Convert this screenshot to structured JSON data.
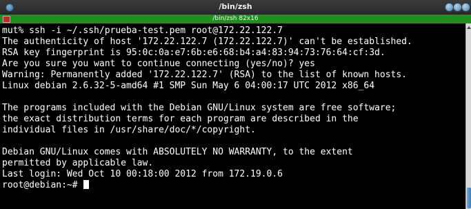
{
  "window": {
    "title": "/bin/zsh"
  },
  "tab": {
    "label": "/bin/zsh 82x16"
  },
  "terminal": {
    "lines": [
      "mut% ssh -i ~/.ssh/prueba-test.pem root@172.22.122.7",
      "The authenticity of host '172.22.122.7 (172.22.122.7)' can't be established.",
      "RSA key fingerprint is 95:0c:0a:e7:6b:e6:68:b4:a4:83:94:73:76:64:cf:3d.",
      "Are you sure you want to continue connecting (yes/no)? yes",
      "Warning: Permanently added '172.22.122.7' (RSA) to the list of known hosts.",
      "Linux debian 2.6.32-5-amd64 #1 SMP Sun May 6 04:00:17 UTC 2012 x86_64",
      "",
      "The programs included with the Debian GNU/Linux system are free software;",
      "the exact distribution terms for each program are described in the",
      "individual files in /usr/share/doc/*/copyright.",
      "",
      "Debian GNU/Linux comes with ABSOLUTELY NO WARRANTY, to the extent",
      "permitted by applicable law.",
      "Last login: Wed Oct 10 00:18:00 2012 from 172.19.0.6",
      "root@debian:~# "
    ]
  },
  "colors": {
    "terminal_bg": "#000000",
    "terminal_fg": "#ffffff",
    "tab_bar": "#1f8f1f",
    "title_bar": "#333333"
  }
}
